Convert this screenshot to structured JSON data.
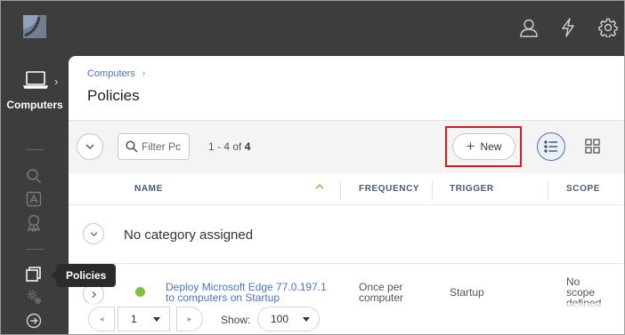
{
  "topbar": {
    "icons": [
      "user-icon",
      "bolt-icon",
      "gear-icon"
    ]
  },
  "sidebar": {
    "section_label": "Computers",
    "items": [
      "search-icon",
      "app-store-icon",
      "badge-icon",
      "policies-icon",
      "settings-gears-icon",
      "arrow-right-circle-icon"
    ],
    "tooltip": "Policies"
  },
  "breadcrumb": {
    "parent": "Computers",
    "separator": "›"
  },
  "page": {
    "title": "Policies"
  },
  "toolbar": {
    "filter_placeholder": "Filter Pc",
    "count_prefix": "1 - 4 of ",
    "count_total": "4",
    "new_label": "New"
  },
  "table": {
    "columns": [
      "NAME",
      "FREQUENCY",
      "TRIGGER",
      "SCOPE"
    ],
    "sort_column": "NAME",
    "sort_direction": "ascending",
    "category": "No category assigned",
    "rows": [
      {
        "status": "enabled",
        "name_line1": "Deploy Microsoft Edge 77.0.197.1",
        "name_line2": "to computers on Startup",
        "frequency_line1": "Once per",
        "frequency_line2": "computer",
        "trigger": "Startup",
        "scope_line1": "No",
        "scope_line2": "scope",
        "scope_line3": "defined"
      }
    ]
  },
  "pager": {
    "page": "1",
    "show_label": "Show:",
    "page_size": "100"
  },
  "colors": {
    "sidebar_bg": "#3d3d3d",
    "link": "#4a74c9",
    "status_green": "#7cc241",
    "highlight_red": "#e01818"
  }
}
